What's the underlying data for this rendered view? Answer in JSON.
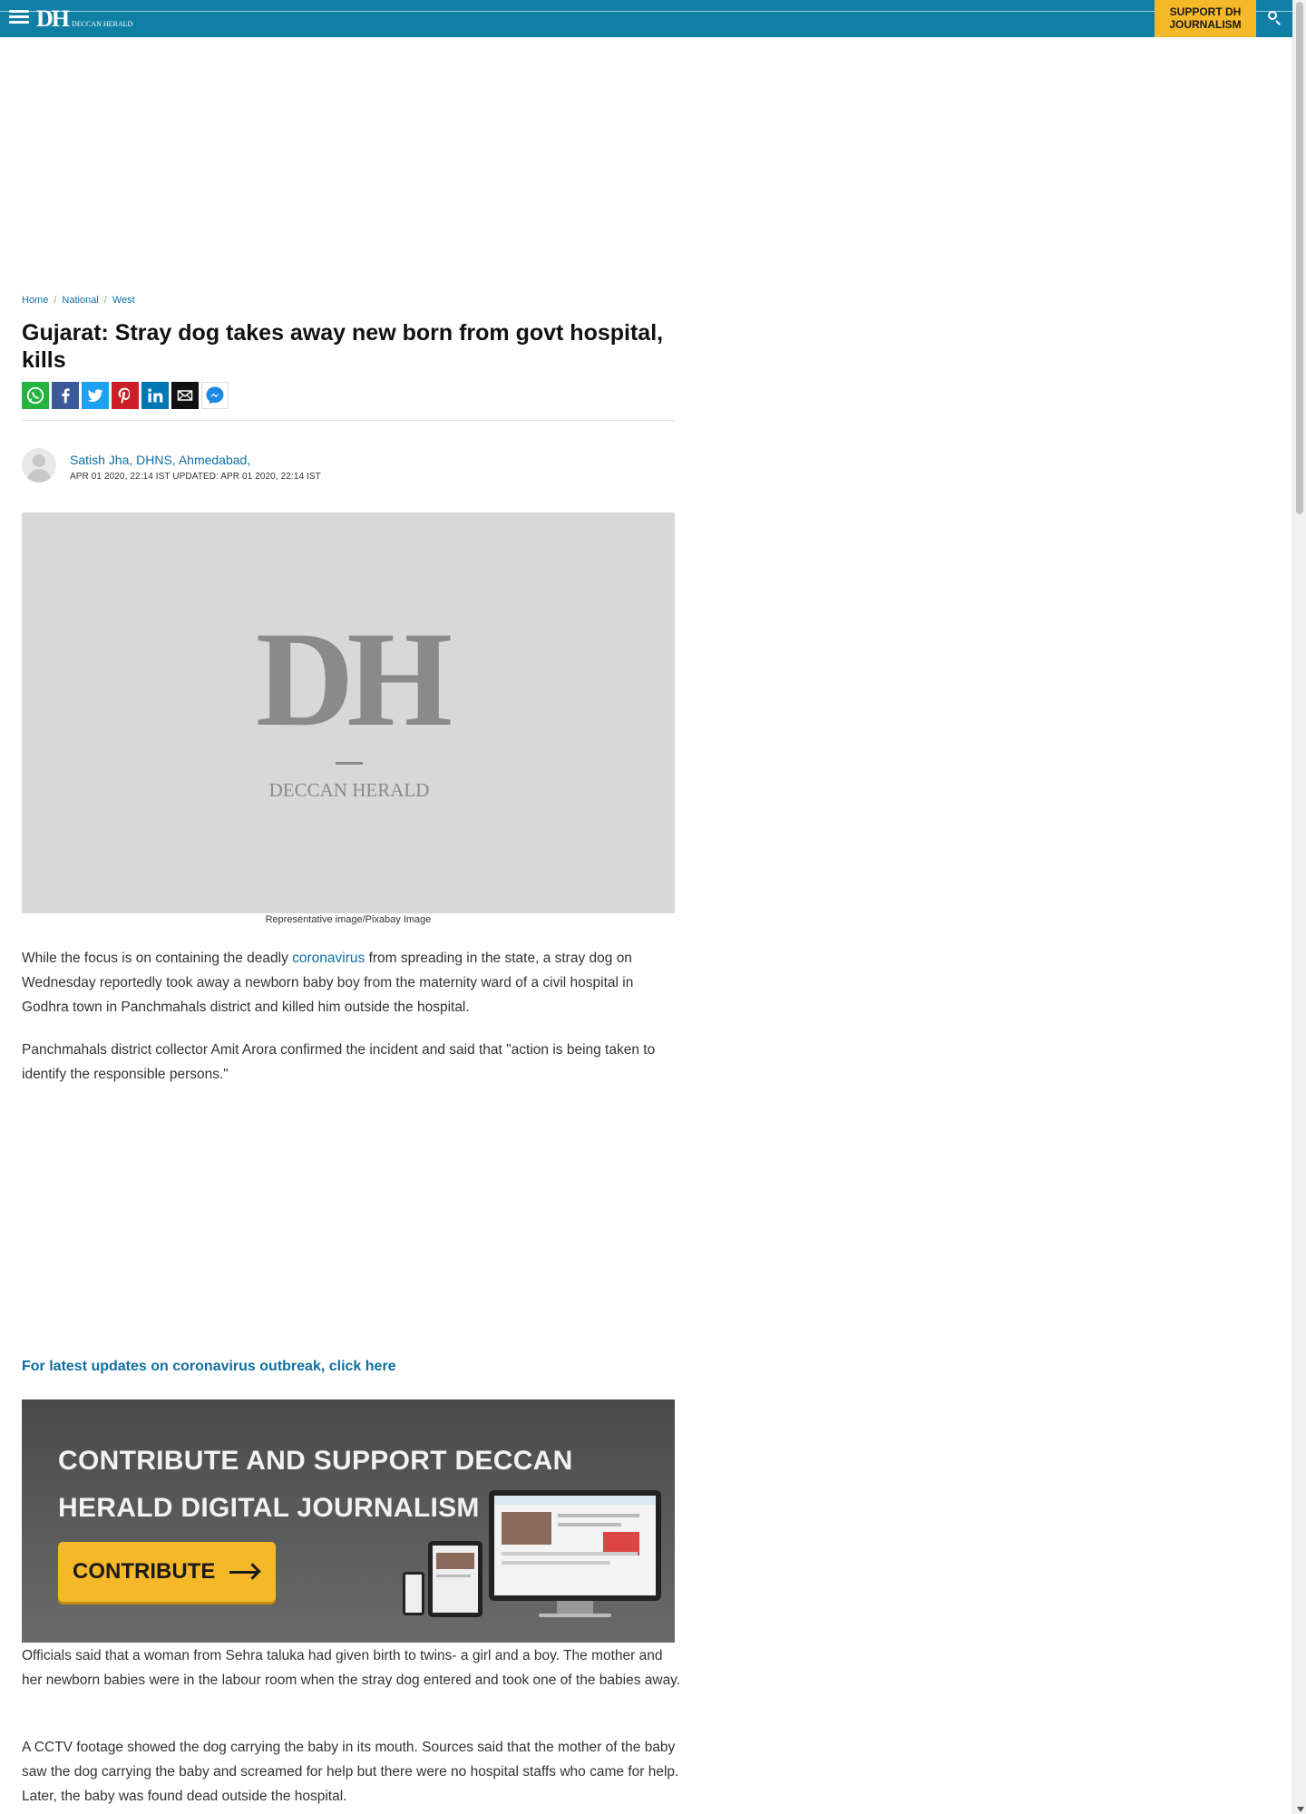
{
  "header": {
    "logo_text": "DH",
    "logo_sub": "DECCAN HERALD",
    "support_label": "SUPPORT DH JOURNALISM",
    "colors": {
      "bar": "#0f7fa6",
      "support_bg": "#f5b829"
    }
  },
  "breadcrumb": [
    "Home",
    "National",
    "West"
  ],
  "article": {
    "headline": "Gujarat: Stray dog takes away new born from govt hospital, kills",
    "share_icons": [
      "whatsapp-icon",
      "facebook-icon",
      "twitter-icon",
      "pinterest-icon",
      "linkedin-icon",
      "email-icon",
      "messenger-icon"
    ],
    "author": "Satish Jha, DHNS, Ahmedabad,",
    "dateline": "APR 01 2020, 22:14 IST UPDATED: APR 01 2020, 22:14 IST",
    "image_placeholder_big": "DH",
    "image_placeholder_small": "DECCAN HERALD",
    "caption": "Representative image/Pixabay Image",
    "p1_before": "While the focus is on containing the deadly ",
    "p1_link": "coronavirus",
    "p1_after": " from spreading in the state, a stray dog on Wednesday reportedly took away a newborn baby boy from the maternity ward of a civil hospital in Godhra town in Panchmahals district and killed him outside the hospital.",
    "p2": "Panchmahals district collector Amit Arora confirmed the incident and said that \"action is being taken to identify the responsible persons.\"",
    "updates_link": "For latest updates on coronavirus outbreak, click here",
    "p3": "Officials said that a woman from Sehra taluka had given birth to twins- a girl and a boy. The mother and her newborn babies were in the labour room when the stray dog entered and took one of the babies away.",
    "p4": "A CCTV footage showed the dog carrying the baby in its mouth. Sources said that the mother of the baby saw the dog carrying the baby and screamed for help but there were no hospital staffs who came for help. Later, the baby was found dead outside the hospital."
  },
  "banner": {
    "line1": "CONTRIBUTE AND SUPPORT DECCAN",
    "line2": "HERALD DIGITAL JOURNALISM",
    "cta": "CONTRIBUTE"
  }
}
